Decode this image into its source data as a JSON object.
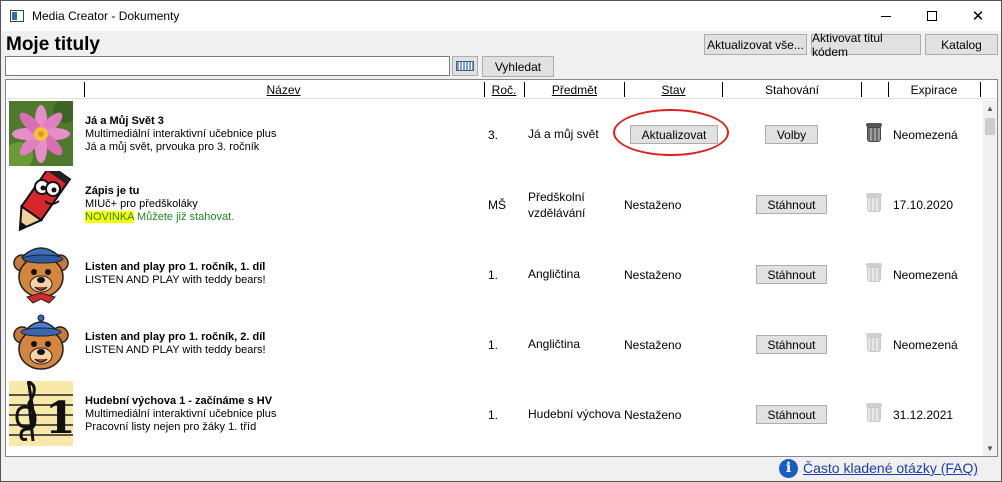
{
  "window": {
    "title": "Media Creator - Dokumenty"
  },
  "header": {
    "title": "Moje tituly"
  },
  "toolbar": {
    "update_all": "Aktualizovat vše...",
    "activate": "Aktivovat titul kódem",
    "catalog": "Katalog"
  },
  "search": {
    "value": "",
    "button": "Vyhledat"
  },
  "columns": {
    "name": "Název",
    "year": "Roč.",
    "subject": "Předmět",
    "status": "Stav",
    "download": "Stahování",
    "expiry": "Expirace"
  },
  "rows": [
    {
      "title": "Já a Můj Svět 3",
      "line1": "Multimediální interaktivní učebnice plus",
      "line2": "Já a můj svět, prvouka pro 3. ročník",
      "year": "3.",
      "subject": "Já a můj svět",
      "status_button": "Aktualizovat",
      "action": "Volby",
      "expiry": "Neomezená",
      "thumb": "lotus-flower"
    },
    {
      "title": "Zápis je tu",
      "line1": "MIUč+ pro předškoláky",
      "badge": "NOVINKA",
      "line2": "Můžete již stahovat.",
      "year": "MŠ",
      "subject": "Předškolní vzdělávání",
      "status": "Nestaženo",
      "action": "Stáhnout",
      "expiry": "17.10.2020",
      "thumb": "pencil-character"
    },
    {
      "title": "Listen and play pro 1. ročník, 1. díl",
      "line1": "LISTEN AND PLAY with teddy bears!",
      "year": "1.",
      "subject": "Angličtina",
      "status": "Nestaženo",
      "action": "Stáhnout",
      "expiry": "Neomezená",
      "thumb": "teddy-bear"
    },
    {
      "title": "Listen and play pro 1. ročník, 2. díl",
      "line1": "LISTEN AND PLAY with teddy bears!",
      "year": "1.",
      "subject": "Angličtina",
      "status": "Nestaženo",
      "action": "Stáhnout",
      "expiry": "Neomezená",
      "thumb": "teddy-bear"
    },
    {
      "title": "Hudební výchova 1 - začínáme s HV",
      "line1": "Multimediální interaktivní učebnice plus",
      "line2": "Pracovní listy nejen pro žáky 1. tříd",
      "year": "1.",
      "subject": "Hudební výchova",
      "status": "Nestaženo",
      "action": "Stáhnout",
      "expiry": "31.12.2021",
      "thumb": "treble-clef"
    }
  ],
  "footer": {
    "faq": "Často kladené otázky (FAQ)"
  },
  "colors": {
    "accent_red": "#e0201c",
    "link_blue": "#1a3cb0",
    "novinka_yellow": "#ffff00",
    "novinka_green": "#1e8a1e"
  }
}
